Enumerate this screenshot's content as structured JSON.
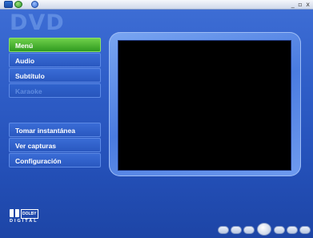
{
  "title_bar": {
    "controls": [
      "_",
      "▫",
      "x"
    ]
  },
  "logo": "DVD",
  "menu_top": [
    {
      "label": "Menú",
      "state": "active"
    },
    {
      "label": "Audio",
      "state": "normal"
    },
    {
      "label": "Subtítulo",
      "state": "normal"
    },
    {
      "label": "Karaoke",
      "state": "disabled"
    }
  ],
  "menu_bottom": [
    {
      "label": "Tomar instantánea"
    },
    {
      "label": "Ver capturas"
    },
    {
      "label": "Configuración"
    }
  ],
  "dolby": {
    "word": "DOLBY",
    "digital": "DIGITAL"
  },
  "colors": {
    "background": "#2f5ec8",
    "active_item": "#3fae2a",
    "screen": "#000000"
  }
}
